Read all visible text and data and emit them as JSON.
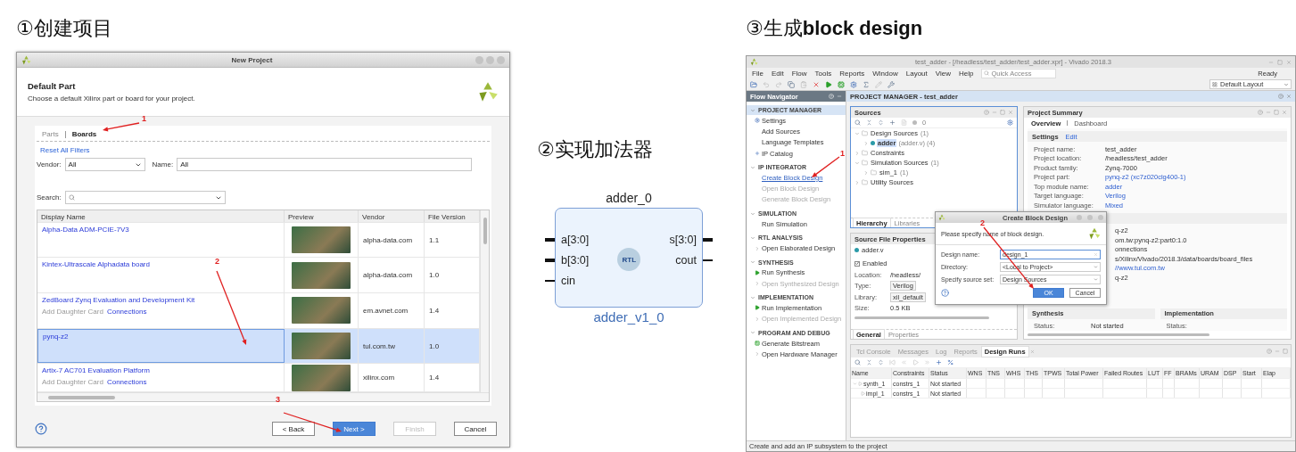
{
  "step1": {
    "heading": "①创建项目",
    "window": {
      "title": "New Project",
      "header_title": "Default Part",
      "header_subtitle": "Choose a default Xilinx part or board for your project.",
      "tabs": [
        {
          "label": "Parts",
          "selected": false
        },
        {
          "label": "Boards",
          "selected": true
        }
      ],
      "reset_link": "Reset All Filters",
      "vendor": {
        "label": "Vendor:",
        "value": "All"
      },
      "name": {
        "label": "Name:",
        "value": "All"
      },
      "search": {
        "label": "Search:"
      },
      "columns": [
        "Display Name",
        "Preview",
        "Vendor",
        "File Version"
      ],
      "rows": [
        {
          "name": "Alpha-Data ADM-PCIE-7V3",
          "vendor": "alpha-data.com",
          "version": "1.1",
          "selected": false
        },
        {
          "name": "Kintex-Ultrascale Alphadata board",
          "vendor": "alpha-data.com",
          "version": "1.0",
          "selected": false
        },
        {
          "name": "ZedBoard Zynq Evaluation and Development Kit",
          "extra": "Add Daughter Card",
          "extra_link": "Connections",
          "vendor": "em.avnet.com",
          "version": "1.4",
          "selected": false
        },
        {
          "name": "pynq-z2",
          "vendor": "tul.com.tw",
          "version": "1.0",
          "selected": true
        },
        {
          "name": "Artix-7 AC701 Evaluation Platform",
          "extra": "Add Daughter Card",
          "extra_link": "Connections",
          "vendor": "xilinx.com",
          "version": "1.4",
          "selected": false
        }
      ],
      "buttons": [
        {
          "label": "< Back",
          "kind": "normal",
          "disabled": false
        },
        {
          "label": "Next >",
          "kind": "primary",
          "disabled": false
        },
        {
          "label": "Finish",
          "kind": "normal",
          "disabled": true
        },
        {
          "label": "Cancel",
          "kind": "normal",
          "disabled": false
        }
      ],
      "annotations": [
        {
          "label": "1"
        },
        {
          "label": "2"
        },
        {
          "label": "3"
        }
      ]
    }
  },
  "step2": {
    "heading": "②实现加法器",
    "instance": "adder_0",
    "inputs": [
      {
        "name": "a[3:0]",
        "kind": "bus"
      },
      {
        "name": "b[3:0]",
        "kind": "bus"
      },
      {
        "name": "cin",
        "kind": "wire"
      }
    ],
    "outputs": [
      {
        "name": "s[3:0]",
        "kind": "bus"
      },
      {
        "name": "cout",
        "kind": "wire"
      }
    ],
    "badge": "RTL",
    "ip_name": "adder_v1_0"
  },
  "step3": {
    "heading": "③生成**block design**",
    "window": {
      "title": "test_adder - [/headless/test_adder/test_adder.xpr] - Vivado 2018.3",
      "menus": [
        "File",
        "Edit",
        "Flow",
        "Tools",
        "Reports",
        "Window",
        "Layout",
        "View",
        "Help"
      ],
      "quick_access": {
        "placeholder": "Quick Access"
      },
      "status": "Ready",
      "layout_select": "Default Layout",
      "flow_navigator": {
        "title": "Flow Navigator",
        "sections": [
          {
            "title": "PROJECT MANAGER",
            "selected": true,
            "items": [
              {
                "label": "Settings",
                "kind": "settings",
                "disabled": false
              },
              {
                "label": "Add Sources",
                "kind": "plain",
                "disabled": false
              },
              {
                "label": "Language Templates",
                "kind": "plain",
                "disabled": false
              },
              {
                "label": "IP Catalog",
                "kind": "catalog",
                "disabled": false
              }
            ]
          },
          {
            "title": "IP INTEGRATOR",
            "selected": false,
            "items": [
              {
                "label": "Create Block Design",
                "kind": "link",
                "disabled": false
              },
              {
                "label": "Open Block Design",
                "kind": "plain",
                "disabled": true
              },
              {
                "label": "Generate Block Design",
                "kind": "plain",
                "disabled": true
              }
            ]
          },
          {
            "title": "SIMULATION",
            "selected": false,
            "items": [
              {
                "label": "Run Simulation",
                "kind": "plain",
                "disabled": false
              }
            ]
          },
          {
            "title": "RTL ANALYSIS",
            "selected": false,
            "items": [
              {
                "label": "Open Elaborated Design",
                "kind": "open",
                "disabled": false
              }
            ]
          },
          {
            "title": "SYNTHESIS",
            "selected": false,
            "items": [
              {
                "label": "Run Synthesis",
                "kind": "run",
                "disabled": false
              },
              {
                "label": "Open Synthesized Design",
                "kind": "open",
                "disabled": true
              }
            ]
          },
          {
            "title": "IMPLEMENTATION",
            "selected": false,
            "items": [
              {
                "label": "Run Implementation",
                "kind": "run",
                "disabled": false
              },
              {
                "label": "Open Implemented Design",
                "kind": "open",
                "disabled": true
              }
            ]
          },
          {
            "title": "PROGRAM AND DEBUG",
            "selected": false,
            "items": [
              {
                "label": "Generate Bitstream",
                "kind": "bitstream",
                "disabled": false
              },
              {
                "label": "Open Hardware Manager",
                "kind": "open",
                "disabled": false
              }
            ]
          }
        ]
      },
      "main_header": "PROJECT MANAGER - test_adder",
      "sources": {
        "title": "Sources",
        "count": "0",
        "tree": [
          {
            "label": "Design Sources",
            "count": "(1)",
            "kind": "folder",
            "expanded": true,
            "selected": false,
            "children": [
              {
                "label": "adder",
                "count": "(adder.v) (4)",
                "kind": "module",
                "expanded": false,
                "selected": true
              }
            ]
          },
          {
            "label": "Constraints",
            "kind": "folder",
            "expanded": false,
            "selected": false
          },
          {
            "label": "Simulation Sources",
            "count": "(1)",
            "kind": "folder",
            "expanded": true,
            "selected": false,
            "children": [
              {
                "label": "sim_1",
                "count": "(1)",
                "kind": "folder",
                "expanded": false,
                "selected": false
              }
            ]
          },
          {
            "label": "Utility Sources",
            "kind": "folder",
            "expanded": false,
            "selected": false
          }
        ],
        "tabs": [
          {
            "label": "Hierarchy",
            "selected": true
          },
          {
            "label": "Libraries",
            "selected": false
          }
        ]
      },
      "file_properties": {
        "title": "Source File Properties",
        "file": "adder.v",
        "enabled": {
          "label": "Enabled",
          "checked": true
        },
        "rows": [
          {
            "label": "Location:",
            "value": "/headless/",
            "kind": "text"
          },
          {
            "label": "Type:",
            "value": "Verilog",
            "kind": "field"
          },
          {
            "label": "Library:",
            "value": "xil_default",
            "kind": "field"
          },
          {
            "label": "Size:",
            "value": "0.5 KB",
            "kind": "text"
          }
        ],
        "tabs": [
          {
            "label": "General",
            "selected": true
          },
          {
            "label": "Properties",
            "selected": false
          }
        ]
      },
      "summary": {
        "title": "Project Summary",
        "tabs": [
          {
            "label": "Overview",
            "selected": true
          },
          {
            "label": "Dashboard",
            "selected": false
          }
        ],
        "settings": {
          "title": "Settings",
          "edit": "Edit",
          "rows": [
            {
              "label": "Project name:",
              "value": "test_adder",
              "link": false
            },
            {
              "label": "Project location:",
              "value": "/headless/test_adder",
              "link": false
            },
            {
              "label": "Product family:",
              "value": "Zynq-7000",
              "link": false
            },
            {
              "label": "Project part:",
              "value": "pynq-z2 (xc7z020clg400-1)",
              "link": true
            },
            {
              "label": "Top module name:",
              "value": "adder",
              "link": true
            },
            {
              "label": "Target language:",
              "value": "Verilog",
              "link": true
            },
            {
              "label": "Simulator language:",
              "value": "Mixed",
              "link": true
            }
          ]
        },
        "board_rows": [
          {
            "value": "q-z2",
            "link": false
          },
          {
            "value": "om.tw:pynq-z2:part0:1.0",
            "link": false
          },
          {
            "value": "onnections",
            "link": false
          },
          {
            "value": "s/Xilinx/Vivado/2018.3/data/boards/board_files",
            "link": false
          },
          {
            "value": "//www.tul.com.tw",
            "link": true
          },
          {
            "value": "q-z2",
            "link": false
          }
        ],
        "synthesis": {
          "title": "Synthesis",
          "status_label": "Status:",
          "status": "Not started"
        },
        "implementation": {
          "title": "Implementation",
          "status_label": "Status:"
        }
      },
      "bottom": {
        "tabs": [
          {
            "label": "Tcl Console",
            "selected": false
          },
          {
            "label": "Messages",
            "selected": false
          },
          {
            "label": "Log",
            "selected": false
          },
          {
            "label": "Reports",
            "selected": false
          },
          {
            "label": "Design Runs",
            "selected": true
          }
        ],
        "columns": [
          "Name",
          "Constraints",
          "Status",
          "WNS",
          "TNS",
          "WHS",
          "THS",
          "TPWS",
          "Total Power",
          "Failed Routes",
          "LUT",
          "FF",
          "BRAMs",
          "URAM",
          "DSP",
          "Start",
          "Elap"
        ],
        "runs": [
          {
            "name": "synth_1",
            "constraints": "constrs_1",
            "status": "Not started",
            "expanded": true,
            "children": [
              {
                "name": "impl_1",
                "constraints": "constrs_1",
                "status": "Not started"
              }
            ]
          }
        ]
      },
      "status_bar": "Create and add an IP subsystem to the project",
      "dialog": {
        "title": "Create Block Design",
        "message": "Please specify name of block design.",
        "fields": [
          {
            "label": "Design name:",
            "value": "design_1",
            "kind": "text"
          },
          {
            "label": "Directory:",
            "value": "<Local to Project>",
            "kind": "select"
          },
          {
            "label": "Specify source set:",
            "value": "Design Sources",
            "kind": "select"
          }
        ],
        "buttons": [
          {
            "label": "OK",
            "kind": "primary"
          },
          {
            "label": "Cancel",
            "kind": "normal"
          }
        ]
      },
      "annotations": [
        {
          "label": "1"
        },
        {
          "label": "2"
        }
      ]
    }
  }
}
